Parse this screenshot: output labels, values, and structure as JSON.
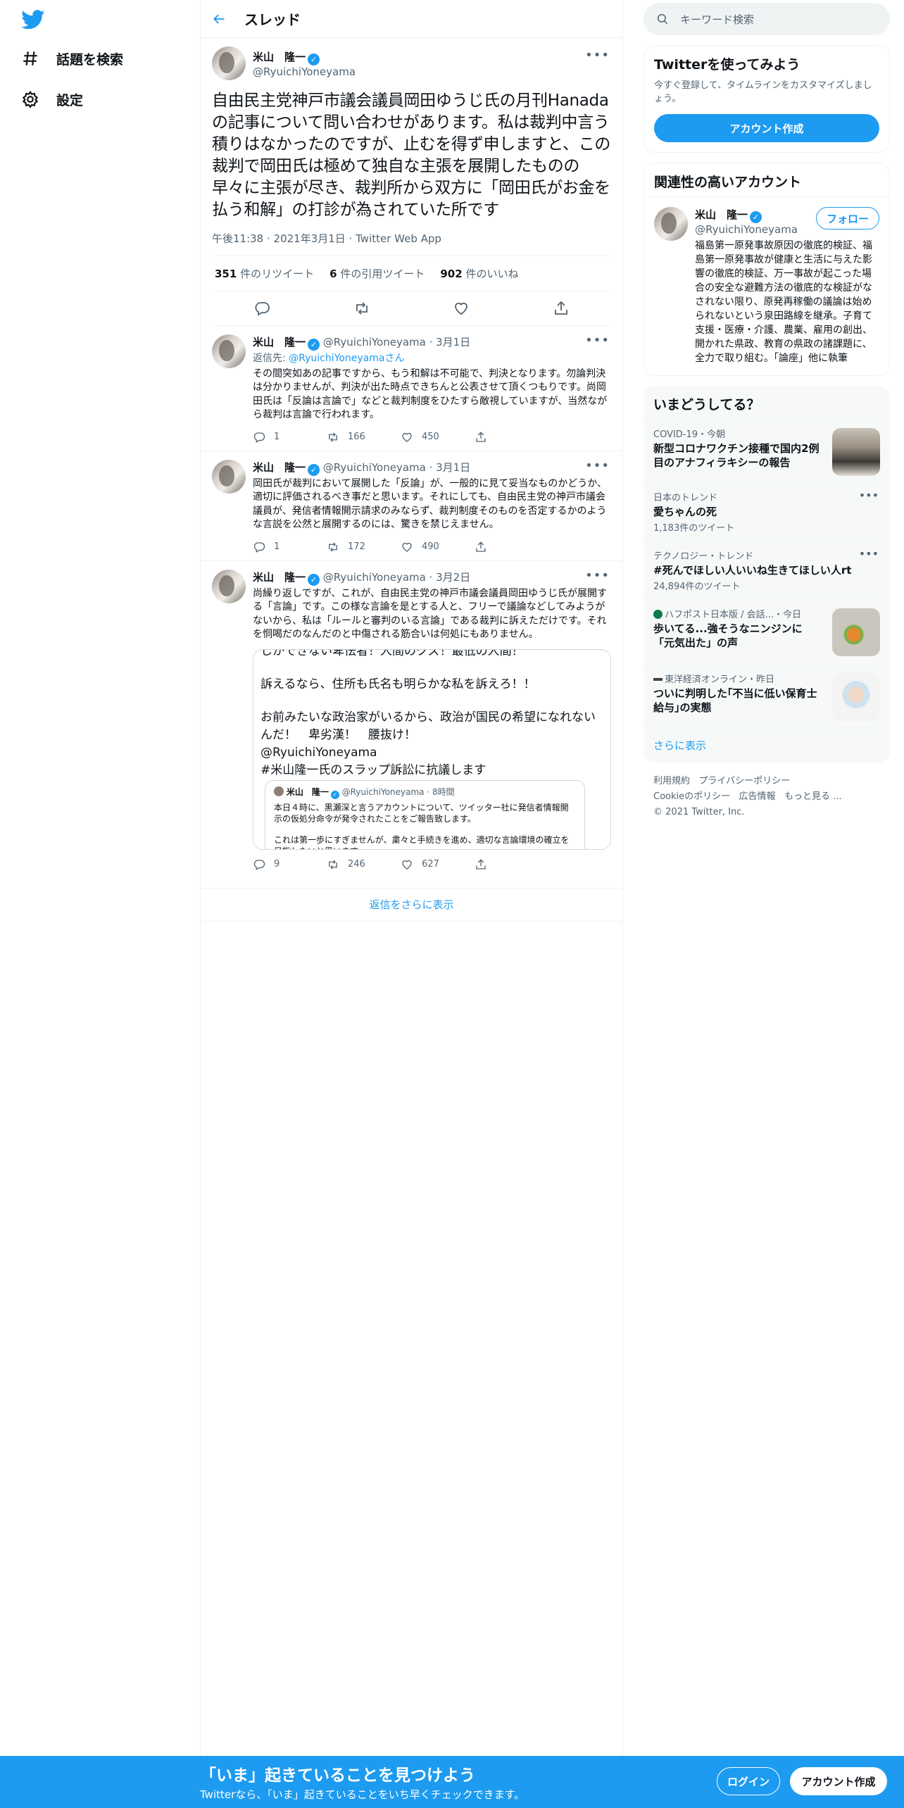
{
  "nav": {
    "explore": "話題を検索",
    "settings": "設定"
  },
  "header": {
    "title": "スレッド"
  },
  "main_tweet": {
    "name": "米山　隆一",
    "handle": "@RyuichiYoneyama",
    "text": "自由民主党神戸市議会議員岡田ゆうじ氏の月刊Hanadaの記事について問い合わせがあります。私は裁判中言う積りはなかったのですが、止むを得ず申しますと、この裁判で岡田氏は極めて独自な主張を展開したものの早々に主張が尽き、裁判所から双方に「岡田氏がお金を払う和解」の打診が為されていた所です",
    "time": "午後11:38",
    "date": "2021年3月1日",
    "source": "Twitter Web App",
    "retweets_count": "351",
    "retweets_label": "件のリツイート",
    "quotes_count": "6",
    "quotes_label": "件の引用ツイート",
    "likes_count": "902",
    "likes_label": "件のいいね"
  },
  "replies": [
    {
      "name": "米山　隆一",
      "handle": "@RyuichiYoneyama",
      "date": "3月1日",
      "reply_prefix": "返信先: ",
      "reply_to": "@RyuichiYoneyama",
      "reply_suffix": "さん",
      "text": "その間突如あの記事ですから、もう和解は不可能で、判決となります。勿論判決は分かりませんが、判決が出た時点できちんと公表させて頂くつもりです。尚岡田氏は「反論は言論で」などと裁判制度をひたすら敵視していますが、当然ながら裁判は言論で行われます。",
      "replies": "1",
      "retweets": "166",
      "likes": "450"
    },
    {
      "name": "米山　隆一",
      "handle": "@RyuichiYoneyama",
      "date": "3月1日",
      "text": "岡田氏が裁判において展開した「反論」が、一般的に見て妥当なものかどうか、適切に評価されるべき事だと思います。それにしても、自由民主党の神戸市議会議員が、発信者情報開示請求のみならず、裁判制度そのものを否定するかのような言説を公然と展開するのには、驚きを禁じえません。",
      "replies": "1",
      "retweets": "172",
      "likes": "490"
    },
    {
      "name": "米山　隆一",
      "handle": "@RyuichiYoneyama",
      "date": "3月2日",
      "text": "尚繰り返しですが、これが、自由民主党の神戸市議会議員岡田ゆうじ氏が展開する「言論」です。この様な言論を是とする人と、フリーで議論などしてみようがないから、私は「ルールと審判のいる言論」である裁判に訴えただけです。それを恫喝だのなんだのと中傷される筋合いは何処にもありません。",
      "embed_line1": "しかできない卑怯者！人間のクズ！最低の人間！",
      "embed_line2": "訴えるなら、住所も氏名も明らかな私を訴えろ！！",
      "embed_line3": "お前みたいな政治家がいるから、政治が国民の希望になれないんだ！　卑劣漢！　腰抜け！",
      "embed_mention": "@RyuichiYoneyama",
      "embed_hashtag": "#米山隆一氏のスラップ訴訟に抗議します",
      "quoted_name": "米山　隆一",
      "quoted_handle": "@RyuichiYoneyama",
      "quoted_time": "8時間",
      "quoted_text1": "本日４時に、黒瀬深と言うアカウントについて、ツイッター社に発信者情報開示の仮処分命令が発令されたことをご報告致します。",
      "quoted_text2": "これは第一歩にすぎませんが、粛々と手続きを進め、適切な言論環境の確立を目指したいと思います。",
      "replies": "9",
      "retweets": "246",
      "likes": "627"
    }
  ],
  "show_more_replies": "返信をさらに表示",
  "right": {
    "search_placeholder": "キーワード検索",
    "signup_title": "Twitterを使ってみよう",
    "signup_sub": "今すぐ登録して、タイムラインをカスタマイズしましょう。",
    "signup_button": "アカウント作成",
    "related_title": "関連性の高いアカウント",
    "related": {
      "name": "米山　隆一",
      "handle": "@RyuichiYoneyama",
      "follow": "フォロー",
      "bio": "福島第一原発事故原因の徹底的検証、福島第一原発事故が健康と生活に与えた影響の徹底的検証、万一事故が起こった場合の安全な避難方法の徹底的な検証がなされない限り、原発再稼働の議論は始められないという泉田路線を継承。子育て支援・医療・介護、農業、雇用の創出、開かれた県政、教育の県政の諸課題に、全力で取り組む。「論座」他に執筆"
    },
    "trends_title": "いまどうしてる？",
    "trends": [
      {
        "context": "COVID-19・今朝",
        "title": "新型コロナワクチン接種で国内2例目のアナフィラキシーの報告",
        "sub": ""
      },
      {
        "context": "日本のトレンド",
        "title": "愛ちゃんの死",
        "sub": "1,183件のツイート"
      },
      {
        "context": "テクノロジー・トレンド",
        "title": "#死んでほしい人いいね生きてほしい人rt",
        "sub": "24,894件のツイート"
      },
      {
        "context": "ハフポスト日本版 / 会話...・今日",
        "title": "歩いてる...強そうなニンジンに「元気出た」の声",
        "sub": ""
      },
      {
        "context": "東洋経済オンライン・昨日",
        "title": "ついに判明した｢不当に低い保育士給与｣の実態",
        "sub": ""
      }
    ],
    "show_more": "さらに表示",
    "footer": {
      "terms": "利用規約",
      "privacy": "プライバシーポリシー",
      "cookie": "Cookieのポリシー",
      "ads": "広告情報",
      "more": "もっと見る ...",
      "copyright": "© 2021 Twitter, Inc."
    }
  },
  "bottom": {
    "title": "「いま」起きていることを見つけよう",
    "sub": "Twitterなら、「いま」起きていることをいち早くチェックできます。",
    "login": "ログイン",
    "signup": "アカウント作成"
  },
  "colors": {
    "accent": "#1d9bf0",
    "text": "#0f1419",
    "secondary": "#536471"
  }
}
